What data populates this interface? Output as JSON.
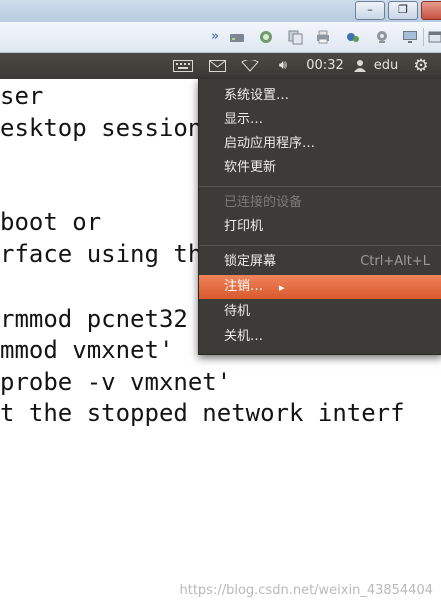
{
  "host_window": {
    "buttons": [
      "–",
      "❐"
    ]
  },
  "host_toolbar": {
    "icons": [
      "chevron-double-right-icon",
      "drive-icon",
      "network-icon",
      "copy-icon",
      "printer-icon",
      "usb-icon",
      "camera-icon",
      "monitor-icon",
      "window-icon"
    ]
  },
  "panel": {
    "clock": "00:32",
    "user": "edu"
  },
  "terminal": {
    "lines": [
      "ser",
      "esktop session",
      "",
      "",
      "boot or",
      "rface using th",
      "",
      "rmmod pcnet32",
      "mmod vmxnet'",
      "probe -v vmxnet'",
      "t the stopped network interf"
    ]
  },
  "menu": {
    "items": [
      {
        "label": "系统设置…"
      },
      {
        "label": "显示…"
      },
      {
        "label": "启动应用程序…"
      },
      {
        "label": "软件更新"
      },
      {
        "label": "已连接的设备"
      },
      {
        "label": "打印机"
      },
      {
        "label": "锁定屏幕",
        "accel": "Ctrl+Alt+L"
      },
      {
        "label": "注销…"
      },
      {
        "label": "待机"
      },
      {
        "label": "关机…"
      }
    ]
  },
  "watermark": "https://blog.csdn.net/weixin_43854404",
  "colors": {
    "menu_bg": "#3c3b37",
    "highlight": "#e46c41",
    "panel_bg": "#3f3e3a"
  }
}
